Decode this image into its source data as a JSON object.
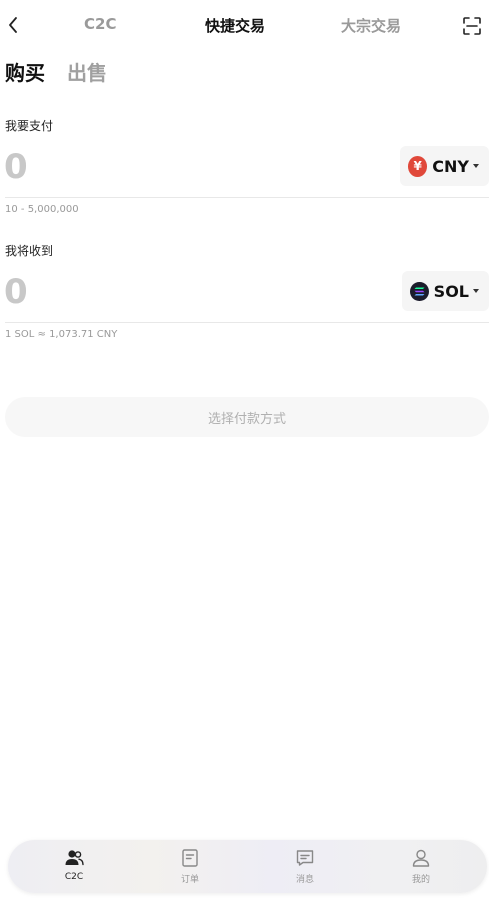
{
  "header": {
    "tabs": [
      {
        "label": "C2C",
        "active": false
      },
      {
        "label": "快捷交易",
        "active": true
      },
      {
        "label": "大宗交易",
        "active": false
      }
    ]
  },
  "trade_side": {
    "buy_label": "购买",
    "sell_label": "出售",
    "selected": "购买"
  },
  "pay": {
    "label": "我要支付",
    "placeholder": "0",
    "currency": "CNY",
    "currency_symbol": "¥",
    "range_hint": "10 - 5,000,000"
  },
  "receive": {
    "label": "我将收到",
    "placeholder": "0",
    "currency": "SOL",
    "rate_hint": "1 SOL ≈ 1,073.71 CNY"
  },
  "payment_method_button": "选择付款方式",
  "bottom_nav": {
    "items": [
      {
        "label": "C2C",
        "icon": "users-icon",
        "active": true
      },
      {
        "label": "订单",
        "icon": "order-icon",
        "active": false
      },
      {
        "label": "消息",
        "icon": "message-icon",
        "active": false
      },
      {
        "label": "我的",
        "icon": "profile-icon",
        "active": false
      }
    ]
  },
  "colors": {
    "cny_logo": "#e0483a",
    "sol_logo_bg": "#1b1b2b",
    "active_text": "#111111",
    "inactive_text": "#9a9a9a"
  }
}
